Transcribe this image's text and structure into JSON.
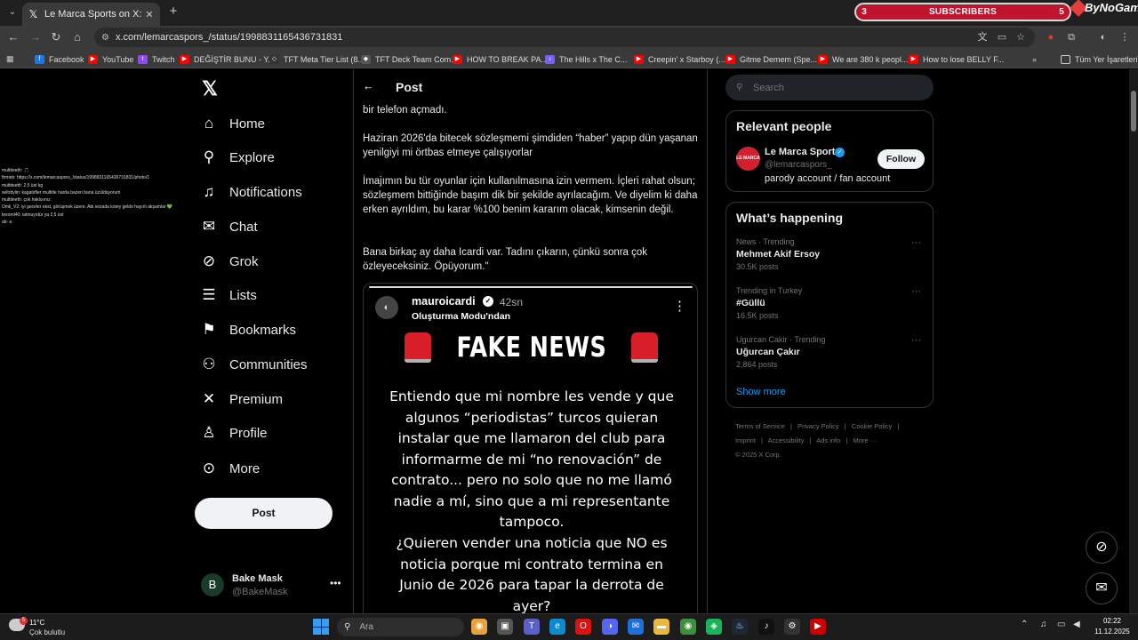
{
  "browser": {
    "tab_title": "Le Marca Sports on X: \"SON DA",
    "url": "x.com/lemarcaspors_/status/1998831165436731831",
    "subscribers": {
      "left_count": "3",
      "label": "SUBSCRIBERS",
      "right_count": "5"
    },
    "brand": "ByNoGame",
    "bookmarks": [
      {
        "label": "Facebook",
        "color": "#1877f2",
        "icon": "f"
      },
      {
        "label": "YouTube",
        "color": "#ff0000",
        "icon": "▶"
      },
      {
        "label": "Twitch",
        "color": "#9146ff",
        "icon": "t"
      },
      {
        "label": "DEĞİŞTİR BUNU - Y...",
        "color": "#ff0000",
        "icon": "▶"
      },
      {
        "label": "TFT Meta Tier List (8...",
        "color": "#333333",
        "icon": "◇"
      },
      {
        "label": "TFT Deck Team Com...",
        "color": "#555555",
        "icon": "◆"
      },
      {
        "label": "HOW TO BREAK PA...",
        "color": "#ff0000",
        "icon": "▶"
      },
      {
        "label": "The Hills x The C...",
        "color": "#7b5cff",
        "icon": "♪"
      },
      {
        "label": "Creepin' x Starboy (...",
        "color": "#ff0000",
        "icon": "▶"
      },
      {
        "label": "Gitme Demem (Spe...",
        "color": "#ff0000",
        "icon": "▶"
      },
      {
        "label": "We are 380 k peopl...",
        "color": "#ff0000",
        "icon": "▶"
      },
      {
        "label": "How to lose BELLY F...",
        "color": "#ff0000",
        "icon": "▶"
      }
    ],
    "all_bookmarks": "Tüm Yer İşaretleri"
  },
  "overlay_chat": [
    "multiteeth: 🎵",
    "ftrmeb: https://x.com/lemarcaspors_/status/1998831165436731831/photo/1",
    "multiteeth: 2.5 üst kg",
    "seltrdylin: kagatirfier multitle harda bazen bana üzüldüyorum",
    "multiteeth: çok haklısınız",
    "Omil_V2: iyi geceler ekst, görüşmek üzere. Abi sezada kotey geldo hayırlı akşamlar 💚",
    "texoml40: iatmuyotür ya 2,5 üst",
    "ab: a"
  ],
  "nav": {
    "items": [
      {
        "label": "Home",
        "icon": "home-icon",
        "glyph": "⌂"
      },
      {
        "label": "Explore",
        "icon": "search-icon",
        "glyph": "⚲"
      },
      {
        "label": "Notifications",
        "icon": "bell-icon",
        "glyph": "♪"
      },
      {
        "label": "Chat",
        "icon": "mail-icon",
        "glyph": "✉"
      },
      {
        "label": "Grok",
        "icon": "grok-icon",
        "glyph": "⊘"
      },
      {
        "label": "Lists",
        "icon": "list-icon",
        "glyph": "☰"
      },
      {
        "label": "Bookmarks",
        "icon": "bookmark-icon",
        "glyph": "❏"
      },
      {
        "label": "Communities",
        "icon": "communities-icon",
        "glyph": "⚇"
      },
      {
        "label": "Premium",
        "icon": "x-icon",
        "glyph": "✕"
      },
      {
        "label": "Profile",
        "icon": "person-icon",
        "glyph": "♙"
      },
      {
        "label": "More",
        "icon": "more-icon",
        "glyph": "⋯"
      }
    ],
    "post_button": "Post",
    "account": {
      "initial": "B",
      "name": "Bake Mask",
      "handle": "@BakeMask",
      "menu": "•••"
    }
  },
  "post": {
    "header": "Post",
    "paragraphs": [
      "bir telefon açmadı.",
      "Haziran 2026'da bitecek sözleşmemi şimdiden “haber” yapıp dün yaşanan yenilgiyi mi örtbas etmeye çalışıyorlar",
      "İmajımın bu tür oyunlar için kullanılmasına izin vermem. İçleri rahat olsun; sözleşmem bittiğinde başım dik bir şekilde ayrılacağım. Ve diyelim ki daha erken ayrıldım, bu karar %100 benim kararım olacak, kimsenin değil.",
      "Bana birkaç ay daha Icardi var. Tadını çıkarın, çünkü sonra çok özleyeceksiniz. Öpüyorum.\""
    ],
    "media": {
      "username": "mauroicardi",
      "time": "42sn",
      "mode": "Oluşturma Modu'ndan",
      "headline": "FAKE NEWS",
      "quote1": "Entiendo que mi nombre les vende y que algunos “periodistas” turcos quieran instalar que me llamaron del club para informarme de mi “no renovación” de contrato... pero no solo que no me llamó nadie a mí, sino que a mi representante tampoco.",
      "quote2": "¿Quieren vender una noticia que NO es noticia porque mi contrato termina en Junio de 2026 para tapar la derrota de ayer?"
    }
  },
  "sidebar": {
    "search_placeholder": "Search",
    "relevant": {
      "title": "Relevant people",
      "avatar_text": "LE MARCA",
      "name": "Le Marca Sports",
      "handle": "@lemarcaspors_",
      "bio": "parody account / fan account",
      "follow": "Follow"
    },
    "happening": {
      "title": "What’s happening",
      "trends": [
        {
          "meta": "News · Trending",
          "name": "Mehmet Akif Ersoy",
          "count": "30.5K posts"
        },
        {
          "meta": "Trending in Turkey",
          "name": "#Güllü",
          "count": "16.5K posts"
        },
        {
          "meta": "Ugurcan Cakir · Trending",
          "name": "Uğurcan Çakır",
          "count": "2,864 posts"
        }
      ],
      "show_more": "Show more"
    },
    "footer": {
      "line1": [
        "Terms of Service",
        "|",
        "Privacy Policy",
        "|",
        "Cookie Policy",
        "|"
      ],
      "line2": [
        "Imprint",
        "|",
        "Accessibility",
        "|",
        "Ads info",
        "|",
        "More ···"
      ],
      "copyright": "© 2025 X Corp."
    }
  },
  "taskbar": {
    "weather_temp": "11°C",
    "weather_desc": "Çok bulutlu",
    "weather_badge": "5",
    "search_placeholder": "Ara",
    "time": "02:22",
    "date": "11.12.2025"
  }
}
